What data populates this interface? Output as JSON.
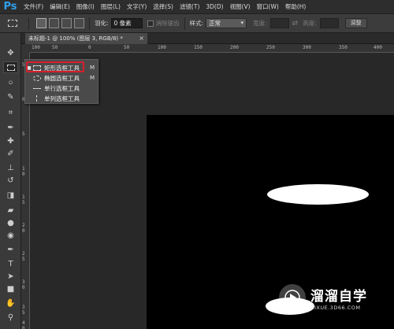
{
  "app": {
    "logo": "Ps",
    "accent": "#2fa0ec"
  },
  "menu": [
    "文件(F)",
    "编辑(E)",
    "图像(I)",
    "图层(L)",
    "文字(Y)",
    "选择(S)",
    "滤镜(T)",
    "3D(D)",
    "视图(V)",
    "窗口(W)",
    "帮助(H)"
  ],
  "options": {
    "feather_label": "羽化:",
    "feather_value": "0 像素",
    "antialias_label": "消除锯齿",
    "style_label": "样式:",
    "style_value": "正常",
    "width_label": "宽度:",
    "height_label": "高度:",
    "refine_label": "调整"
  },
  "document": {
    "tab_title": "未标题-1 @ 100% (图层 3, RGB/8) *",
    "close": "×"
  },
  "ruler": {
    "h_ticks": [
      "100",
      "50",
      "0",
      "50",
      "100",
      "150",
      "200",
      "250",
      "300",
      "350",
      "400"
    ],
    "v_ticks": [
      "5",
      "0",
      "5",
      "1 0",
      "1 5",
      "2 0",
      "2 5",
      "3 0",
      "3 5",
      "4 0"
    ]
  },
  "flyout": {
    "items": [
      {
        "label": "矩形选框工具",
        "shortcut": "M",
        "icon": "rect-marquee-icon",
        "selected": true
      },
      {
        "label": "椭圆选框工具",
        "shortcut": "M",
        "icon": "ellipse-marquee-icon",
        "selected": false
      },
      {
        "label": "单行选框工具",
        "shortcut": "",
        "icon": "single-row-marquee-icon",
        "selected": false
      },
      {
        "label": "单列选框工具",
        "shortcut": "",
        "icon": "single-column-marquee-icon",
        "selected": false
      }
    ],
    "highlight_color": "#d81e2c"
  },
  "tools": [
    "move-tool-icon",
    "rect-marquee-tool-icon",
    "lasso-tool-icon",
    "quick-select-tool-icon",
    "crop-tool-icon",
    "eyedropper-tool-icon",
    "spot-healing-tool-icon",
    "brush-tool-icon",
    "clone-stamp-tool-icon",
    "history-brush-tool-icon",
    "eraser-tool-icon",
    "gradient-tool-icon",
    "blur-tool-icon",
    "dodge-tool-icon",
    "pen-tool-icon",
    "type-tool-icon",
    "path-select-tool-icon",
    "rectangle-shape-tool-icon",
    "hand-tool-icon",
    "zoom-tool-icon"
  ],
  "watermark": {
    "title": "溜溜自学",
    "url": "ZIXUE.3D66.COM"
  }
}
